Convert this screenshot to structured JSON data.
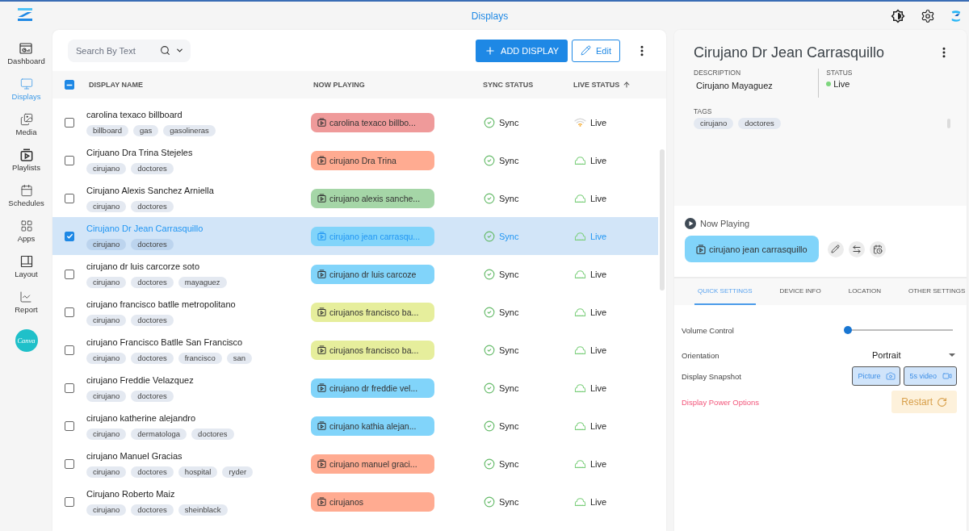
{
  "top_bar": {
    "title": "Displays"
  },
  "sidebar": {
    "items": [
      {
        "label": "Dashboard",
        "selected": false
      },
      {
        "label": "Displays",
        "selected": true
      },
      {
        "label": "Media",
        "selected": false
      },
      {
        "label": "Playlists",
        "selected": false
      },
      {
        "label": "Schedules",
        "selected": false
      },
      {
        "label": "Apps",
        "selected": false
      },
      {
        "label": "Layout",
        "selected": false
      },
      {
        "label": "Report",
        "selected": false
      }
    ],
    "app_button": "Canva"
  },
  "toolbar": {
    "search": {
      "placeholder": "Search By Text"
    },
    "add_button": "ADD DISPLAY",
    "edit_button": "Edit"
  },
  "table": {
    "select_all": {
      "indeterminate": true
    },
    "columns": [
      {
        "label": "DISPLAY NAME",
        "sorted": false
      },
      {
        "label": "NOW PLAYING",
        "sorted": false
      },
      {
        "label": "SYNC STATUS",
        "sorted": false
      },
      {
        "label": "LIVE STATUS",
        "sorted": true
      }
    ],
    "rows": [
      {
        "name": "carolina texaco billboard",
        "tags": [
          "billboard",
          "gas",
          "gasolineras"
        ],
        "checked": false,
        "selected": false,
        "now_playing": {
          "label": "carolina texaco billbo...",
          "color": "#ef9a9a"
        },
        "sync": "Sync",
        "live": {
          "label": "Live",
          "kind": "wifi"
        }
      },
      {
        "name": "Cirjuano Dra Trina Stejeles",
        "tags": [
          "cirujano",
          "doctores"
        ],
        "checked": false,
        "selected": false,
        "now_playing": {
          "label": "cirujano Dra Trina",
          "color": "#ffab91"
        },
        "sync": "Sync",
        "live": {
          "label": "Live",
          "kind": "cloud"
        }
      },
      {
        "name": "Cirujano Alexis Sanchez Arniella",
        "tags": [
          "cirujano",
          "doctores"
        ],
        "checked": false,
        "selected": false,
        "now_playing": {
          "label": "cirujano alexis sanche...",
          "color": "#a5d6a7"
        },
        "sync": "Sync",
        "live": {
          "label": "Live",
          "kind": "cloud"
        }
      },
      {
        "name": "Cirujano Dr Jean Carrasquillo",
        "tags": [
          "cirujano",
          "doctores"
        ],
        "checked": true,
        "selected": true,
        "now_playing": {
          "label": "cirujano jean carrasqu...",
          "color": "#81d4fa"
        },
        "sync": "Sync",
        "live": {
          "label": "Live",
          "kind": "cloud"
        }
      },
      {
        "name": "cirujano dr luis carcorze soto",
        "tags": [
          "cirujano",
          "doctores",
          "mayaguez"
        ],
        "checked": false,
        "selected": false,
        "now_playing": {
          "label": "cirujano dr luis carcoze",
          "color": "#81d4fa"
        },
        "sync": "Sync",
        "live": {
          "label": "Live",
          "kind": "cloud"
        }
      },
      {
        "name": "cirujano francisco batlle metropolitano",
        "tags": [
          "cirujano",
          "doctores"
        ],
        "checked": false,
        "selected": false,
        "now_playing": {
          "label": "cirujanos francisco ba...",
          "color": "#e6ee9c"
        },
        "sync": "Sync",
        "live": {
          "label": "Live",
          "kind": "cloud"
        }
      },
      {
        "name": "cirujano Francisco Batlle San Francisco",
        "tags": [
          "cirujano",
          "doctores",
          "francisco",
          "san"
        ],
        "checked": false,
        "selected": false,
        "now_playing": {
          "label": "cirujanos francisco ba...",
          "color": "#e6ee9c"
        },
        "sync": "Sync",
        "live": {
          "label": "Live",
          "kind": "cloud"
        }
      },
      {
        "name": "cirujano Freddie Velazquez",
        "tags": [
          "cirujano",
          "doctores"
        ],
        "checked": false,
        "selected": false,
        "now_playing": {
          "label": "cirujano dr freddie vel...",
          "color": "#81d4fa"
        },
        "sync": "Sync",
        "live": {
          "label": "Live",
          "kind": "cloud"
        }
      },
      {
        "name": "cirujano katherine alejandro",
        "tags": [
          "cirujano",
          "dermatologa",
          "doctores"
        ],
        "checked": false,
        "selected": false,
        "now_playing": {
          "label": "cirujano kathia alejan...",
          "color": "#81d4fa"
        },
        "sync": "Sync",
        "live": {
          "label": "Live",
          "kind": "cloud"
        }
      },
      {
        "name": "cirujano Manuel Gracias",
        "tags": [
          "cirujano",
          "doctores",
          "hospital",
          "ryder"
        ],
        "checked": false,
        "selected": false,
        "now_playing": {
          "label": "cirujano manuel graci...",
          "color": "#ffab91"
        },
        "sync": "Sync",
        "live": {
          "label": "Live",
          "kind": "cloud"
        }
      },
      {
        "name": "Cirujano Roberto Maiz",
        "tags": [
          "cirujano",
          "doctores",
          "sheinblack"
        ],
        "checked": false,
        "selected": false,
        "now_playing": {
          "label": "cirujanos",
          "color": "#ffab91"
        },
        "sync": "Sync",
        "live": {
          "label": "Live",
          "kind": "cloud"
        }
      }
    ]
  },
  "details": {
    "title": "Cirujano Dr Jean Carrasquillo",
    "description": {
      "label": "DESCRIPTION",
      "value": "Cirujano Mayaguez"
    },
    "status": {
      "label": "STATUS",
      "value": "Live",
      "online": true
    },
    "tags": {
      "label": "TAGS",
      "items": [
        "cirujano",
        "doctores"
      ]
    },
    "now_playing": {
      "label": "Now Playing",
      "playlist": "cirujano jean carrasquillo",
      "color": "#81d4fa"
    },
    "tabs": [
      {
        "label": "QUICK SETTINGS",
        "selected": true
      },
      {
        "label": "DEVICE INFO",
        "selected": false
      },
      {
        "label": "LOCATION",
        "selected": false
      },
      {
        "label": "OTHER SETTINGS",
        "selected": false
      }
    ],
    "settings": [
      {
        "kind": "slider",
        "label": "Volume Control",
        "level": 0
      },
      {
        "kind": "select",
        "label": "Orientation",
        "value": "Portrait"
      },
      {
        "kind": "buttons",
        "label": "Display Snapshot",
        "buttons": [
          "Picture",
          "5s video"
        ]
      },
      {
        "kind": "action",
        "label": "Display Power Options",
        "button": "Restart"
      }
    ]
  }
}
